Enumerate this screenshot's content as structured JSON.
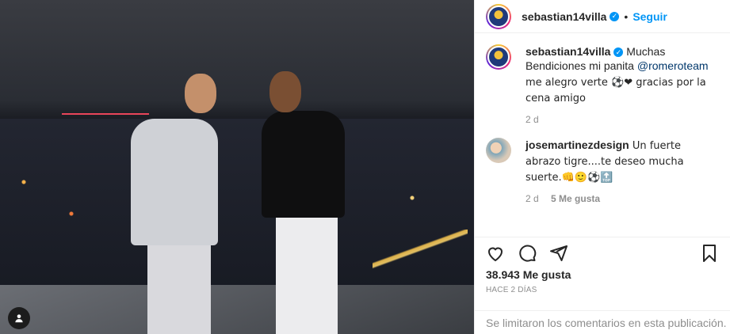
{
  "header": {
    "username": "sebastian14villa",
    "separator": "•",
    "follow_label": "Seguir"
  },
  "caption": {
    "username": "sebastian14villa",
    "text_pre": " Muchas Bendiciones mi panita ",
    "mention": "@romeroteam",
    "text_post": " me alegro verte ⚽❤ gracias por la cena amigo",
    "time": "2 d"
  },
  "comments": [
    {
      "username": "josemartinezdesign",
      "text": " Un fuerte abrazo tigre....te deseo mucha suerte.👊🙂⚽🔝",
      "time": "2 d",
      "likes": "5 Me gusta"
    }
  ],
  "actions": {
    "icons": [
      "heart-icon",
      "comment-icon",
      "share-icon",
      "bookmark-icon"
    ]
  },
  "stats": {
    "likes": "38.943 Me gusta",
    "ago": "HACE 2 DÍAS"
  },
  "footer": {
    "limited": "Se limitaron los comentarios en esta publicación."
  },
  "colors": {
    "accent": "#0095f6",
    "mention": "#00376b",
    "muted": "#8e8e8e"
  }
}
